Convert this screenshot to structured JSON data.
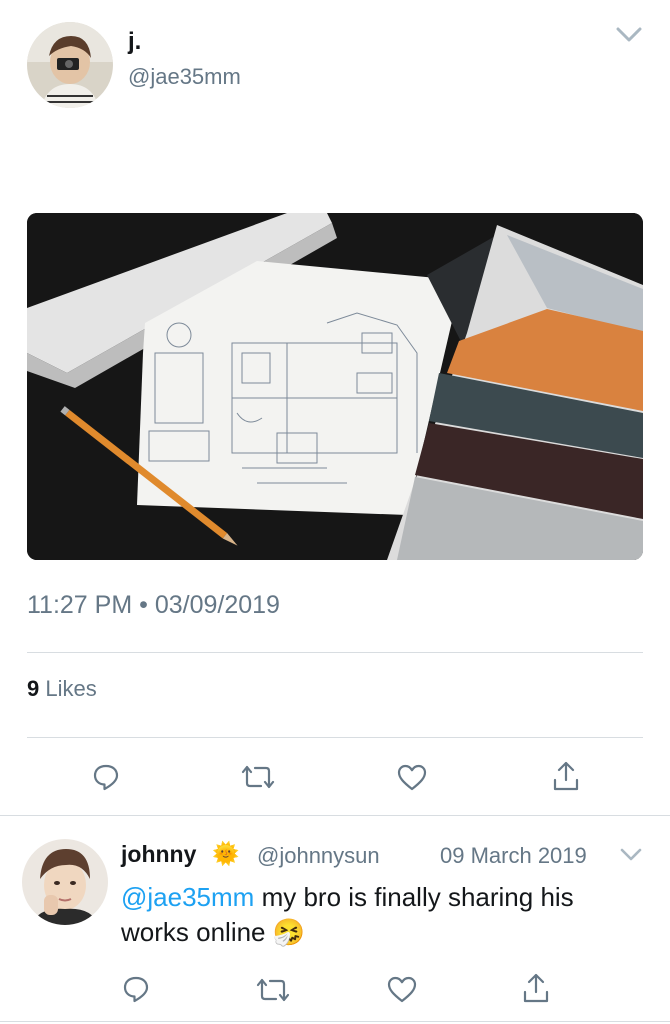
{
  "tweet": {
    "author_name": "j.",
    "author_handle": "@jae35mm",
    "time": "11:27 PM",
    "separator": "•",
    "date": "03/09/2019",
    "likes_count": "9",
    "likes_label": "Likes",
    "image_icon": "blueprint-photo"
  },
  "reply": {
    "author_name": "johnny",
    "badge_emoji": "🌞",
    "author_handle": "@johnnysun",
    "date": "09 March 2019",
    "mention": "@jae35mm",
    "text": "my bro is finally sharing his works online",
    "emoji": "🤧"
  },
  "icons": {
    "reply": "reply-icon",
    "retweet": "retweet-icon",
    "like": "heart-icon",
    "share": "share-icon",
    "more": "chevron-down-icon"
  },
  "colors": {
    "text": "#14171a",
    "muted": "#657786",
    "link": "#1da1f2",
    "divider": "#d8dde1"
  }
}
